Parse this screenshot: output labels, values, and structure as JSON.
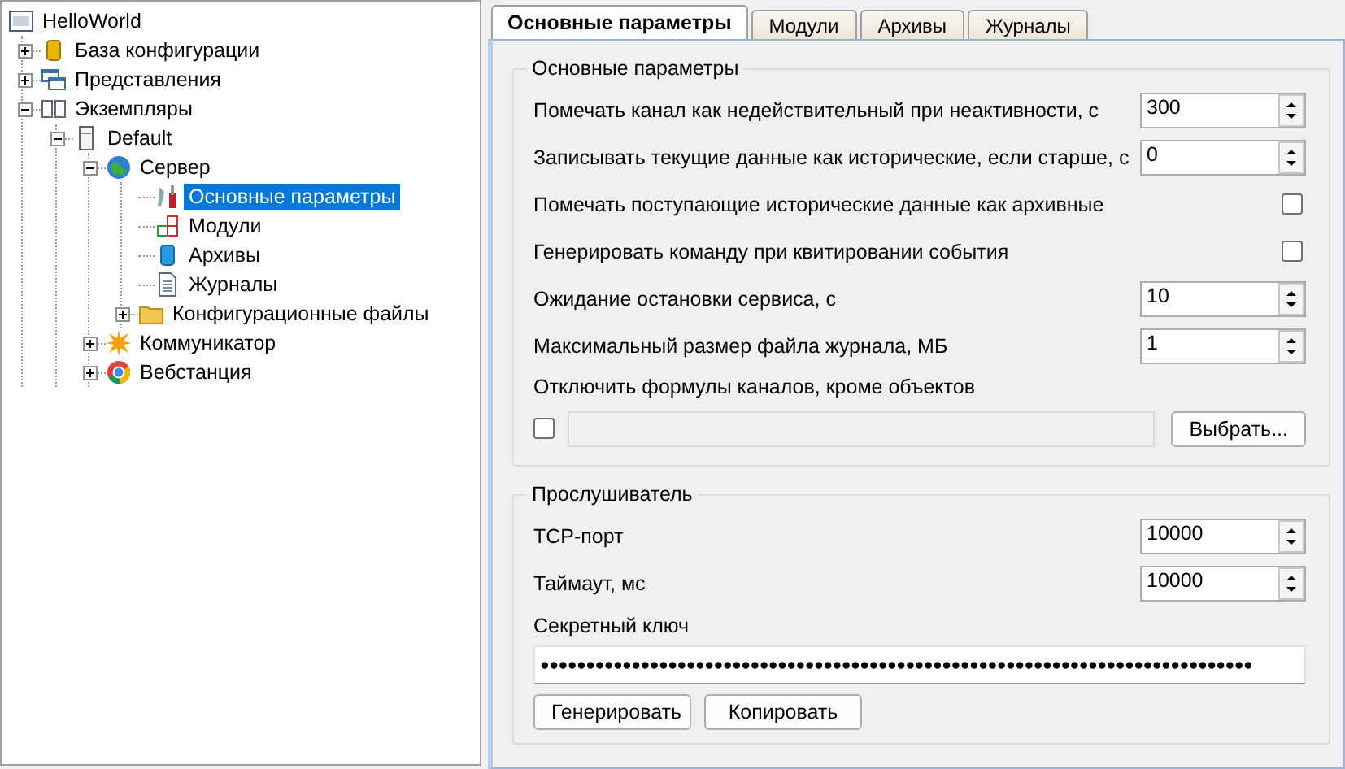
{
  "tree": [
    {
      "label": "HelloWorld",
      "kind": "rs",
      "selected": false,
      "children": [
        {
          "label": "База конфигурации",
          "kind": "db",
          "expanded": false,
          "selected": false
        },
        {
          "label": "Представления",
          "kind": "windows",
          "expanded": false,
          "selected": false
        },
        {
          "label": "Экземпляры",
          "kind": "instances",
          "expanded": true,
          "selected": false,
          "children": [
            {
              "label": "Default",
              "kind": "server",
              "expanded": true,
              "selected": false,
              "children": [
                {
                  "label": "Сервер",
                  "kind": "globe",
                  "expanded": true,
                  "selected": false,
                  "children": [
                    {
                      "label": "Основные параметры",
                      "kind": "tools",
                      "selected": true
                    },
                    {
                      "label": "Модули",
                      "kind": "modules",
                      "selected": false
                    },
                    {
                      "label": "Архивы",
                      "kind": "archive",
                      "selected": false
                    },
                    {
                      "label": "Журналы",
                      "kind": "doc",
                      "selected": false
                    },
                    {
                      "label": "Конфигурационные файлы",
                      "kind": "folder",
                      "expanded": false,
                      "selected": false
                    }
                  ]
                },
                {
                  "label": "Коммуникатор",
                  "kind": "sun",
                  "expanded": false,
                  "selected": false
                },
                {
                  "label": "Вебстанция",
                  "kind": "chrome",
                  "expanded": false,
                  "selected": false
                }
              ]
            }
          ]
        }
      ]
    }
  ],
  "tabs": [
    {
      "label": "Основные параметры",
      "selected": true
    },
    {
      "label": "Модули",
      "selected": false
    },
    {
      "label": "Архивы",
      "selected": false
    },
    {
      "label": "Журналы",
      "selected": false
    }
  ],
  "main_group": {
    "title": "Основные параметры",
    "rows": [
      {
        "kind": "spin",
        "label": "Помечать канал как недействительный при неактивности, с",
        "value": "300"
      },
      {
        "kind": "spin",
        "label": "Записывать текущие данные как исторические, если старше, с",
        "value": "0"
      },
      {
        "kind": "check",
        "label": "Помечать поступающие исторические данные как архивные",
        "checked": false
      },
      {
        "kind": "check",
        "label": "Генерировать команду при квитировании события",
        "checked": false
      },
      {
        "kind": "spin",
        "label": "Ожидание остановки сервиса, с",
        "value": "10"
      },
      {
        "kind": "spin",
        "label": "Максимальный размер файла журнала, МБ",
        "value": "1"
      }
    ],
    "formula": {
      "label": "Отключить формулы каналов, кроме объектов",
      "checked": false,
      "button": "Выбрать..."
    }
  },
  "listener": {
    "title": "Прослушиватель",
    "rows": [
      {
        "kind": "spin",
        "label": "TCP-порт",
        "value": "10000"
      },
      {
        "kind": "spin",
        "label": "Таймаут, мс",
        "value": "10000"
      }
    ],
    "secret": {
      "label": "Секретный ключ",
      "value": "●●●●●●●●●●●●●●●●●●●●●●●●●●●●●●●●●●●●●●●●●●●●●●●●●●●●●●●●●●●●●●●●●●●●●●●●●●●●●●"
    },
    "buttons": [
      "Генерировать",
      "Копировать"
    ]
  }
}
